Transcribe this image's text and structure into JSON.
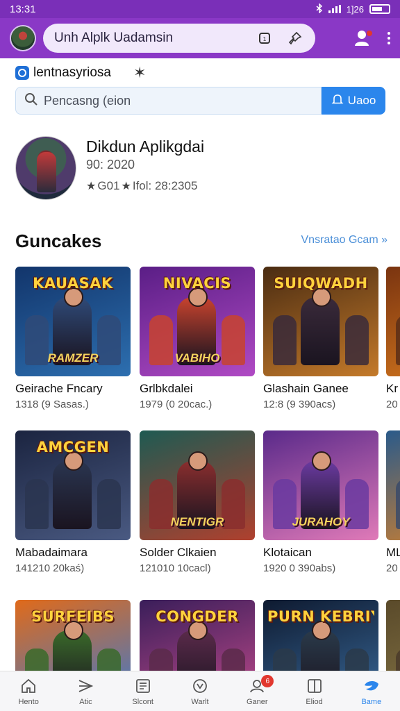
{
  "status": {
    "time": "13:31",
    "network": "1]26"
  },
  "app_bar": {
    "address_text": "Unh Alplk Uadamsin"
  },
  "site": {
    "name": "lentnasyriosa"
  },
  "search": {
    "placeholder": "Pencasng (eion",
    "button_label": "Uaoo"
  },
  "profile": {
    "name": "Dikdun Aplikgdai",
    "date": "90: 2020",
    "meta_a": "G01",
    "meta_b": "Ifol: 28:2305"
  },
  "section": {
    "title": "Guncakes",
    "link": "Vnsratao Gcam »"
  },
  "games": [
    {
      "title": "Geirache Fncary",
      "meta": "1318 (9 Sasas.)",
      "art_title": "KAUASAK",
      "art_sub": "RAMZER",
      "bg_from": "#12356b",
      "bg_to": "#2d6fb0",
      "hero": "#2f4a78"
    },
    {
      "title": "Grlbkdalei",
      "meta": "1979 (0 20cac.)",
      "art_title": "NIVACIS",
      "art_sub": "VABIHO",
      "bg_from": "#5a1e86",
      "bg_to": "#b04ac4",
      "hero": "#c8432e"
    },
    {
      "title": "Glashain Ganee",
      "meta": "12:8 (9 390acs)",
      "art_title": "SUIQWADH",
      "art_sub": "",
      "bg_from": "#4a2c12",
      "bg_to": "#c47a2a",
      "hero": "#3a2a3a"
    },
    {
      "title": "Kr",
      "meta": "20",
      "art_title": "",
      "art_sub": "",
      "bg_from": "#7a3410",
      "bg_to": "#d87a1e",
      "hero": "#5a2e18"
    },
    {
      "title": "Mabadaimara",
      "meta": "141210 20kaś)",
      "art_title": "AMCGEN",
      "art_sub": "",
      "bg_from": "#1b2440",
      "bg_to": "#4a5a82",
      "hero": "#2a3550"
    },
    {
      "title": "Solder Clkaien",
      "meta": "121010 10cacl)",
      "art_title": "",
      "art_sub": "NENTIGR",
      "bg_from": "#1e5a52",
      "bg_to": "#b0402e",
      "hero": "#8a2e2e"
    },
    {
      "title": "Klotaican",
      "meta": "1920 0 390abs)",
      "art_title": "",
      "art_sub": "JURAHOY",
      "bg_from": "#5a2a8a",
      "bg_to": "#e07ab8",
      "hero": "#6a3aa0"
    },
    {
      "title": "ML",
      "meta": "20",
      "art_title": "",
      "art_sub": "",
      "bg_from": "#2a5a8a",
      "bg_to": "#d8822a",
      "hero": "#3a4a6a"
    },
    {
      "title": "",
      "meta": "",
      "art_title": "SURFEIBS",
      "art_sub": "",
      "bg_from": "#e06a1a",
      "bg_to": "#3a7ad0",
      "hero": "#3a6a2a"
    },
    {
      "title": "",
      "meta": "",
      "art_title": "CONGDER",
      "art_sub": "",
      "bg_from": "#3a1e5a",
      "bg_to": "#c04a8a",
      "hero": "#5a2a4a"
    },
    {
      "title": "",
      "meta": "",
      "art_title": "PURN KEBRIY",
      "art_sub": "",
      "bg_from": "#0e1a30",
      "bg_to": "#3a6a9a",
      "hero": "#2a3a4a"
    },
    {
      "title": "",
      "meta": "",
      "art_title": "",
      "art_sub": "",
      "bg_from": "#5a4a2a",
      "bg_to": "#8a7a4a",
      "hero": "#4a3a2a"
    }
  ],
  "nav": [
    {
      "label": "Hento",
      "icon": "home-icon"
    },
    {
      "label": "Atic",
      "icon": "send-icon"
    },
    {
      "label": "Slcont",
      "icon": "news-icon"
    },
    {
      "label": "Warlt",
      "icon": "compass-icon"
    },
    {
      "label": "Ganer",
      "icon": "profile-icon",
      "badge": "6"
    },
    {
      "label": "Eliod",
      "icon": "book-icon"
    },
    {
      "label": "Bame",
      "icon": "game-icon"
    }
  ],
  "colors": {
    "accent": "#8a38c6",
    "status_bar": "#7a2fb8",
    "primary_button": "#2b86ec",
    "link": "#4b8fd8"
  }
}
